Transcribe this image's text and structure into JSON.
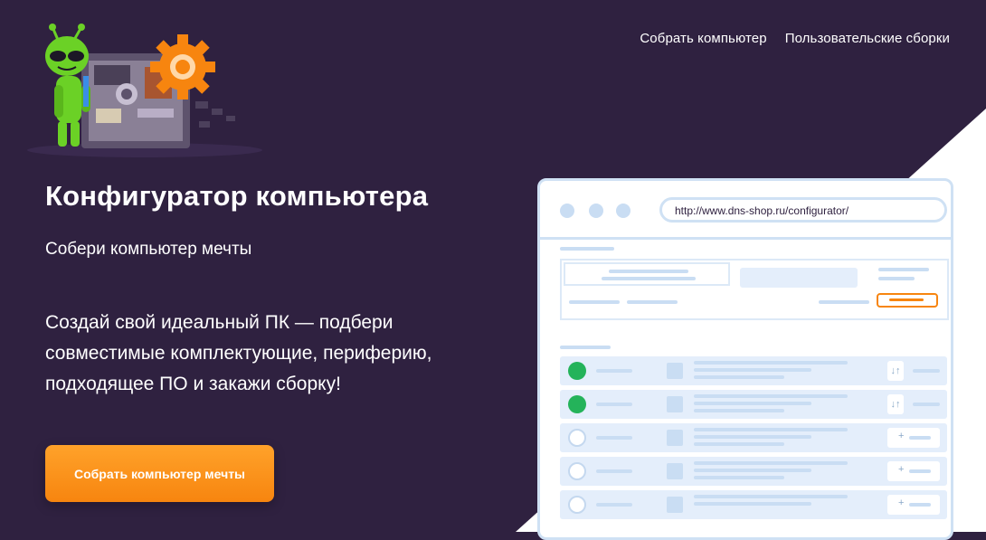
{
  "nav": {
    "items": [
      {
        "label": "Собрать компьютер"
      },
      {
        "label": "Пользовательские сборки"
      }
    ]
  },
  "hero": {
    "title": "Конфигуратор компьютера",
    "subtitle": "Собери компьютер мечты",
    "description": "Создай свой идеальный ПК — подбери совместимые комплектующие, периферию, подходящее ПО и закажи сборку!",
    "cta_label": "Собрать компьютер мечты"
  },
  "mockup": {
    "url": "http://www.dns-shop.ru/configurator/",
    "rows": [
      {
        "checked": true,
        "icon": "cpu-icon",
        "control": "sort"
      },
      {
        "checked": true,
        "icon": "motherboard-icon",
        "control": "sort"
      },
      {
        "checked": false,
        "icon": "gpu-icon",
        "control": "add"
      },
      {
        "checked": false,
        "icon": "ram-icon",
        "control": "add"
      },
      {
        "checked": false,
        "icon": "drive-icon",
        "control": "add"
      }
    ]
  },
  "colors": {
    "background": "#2f2140",
    "accent": "#f7850f",
    "mascot_green": "#6bd126",
    "check_green": "#24b35a",
    "mockup_border": "#cfe1f4"
  },
  "mascot": {
    "name": "alien-mascot"
  }
}
